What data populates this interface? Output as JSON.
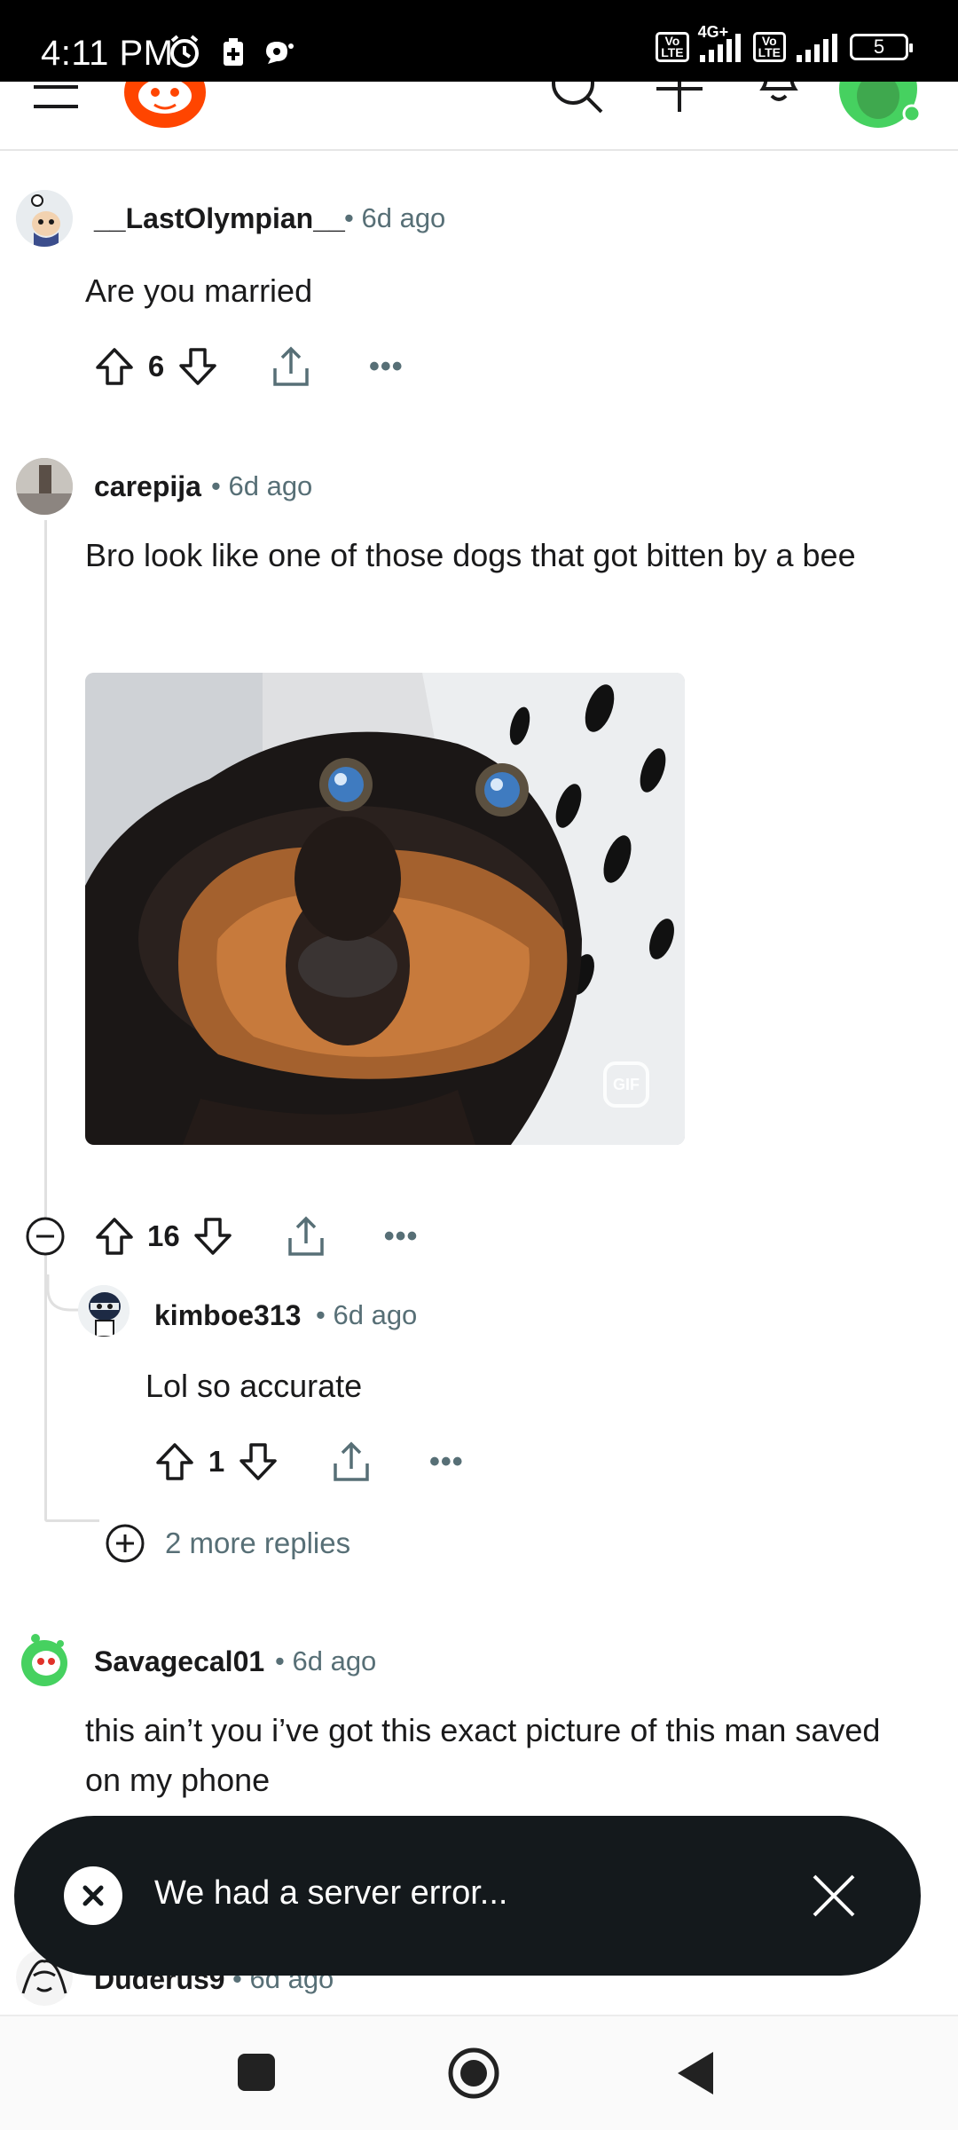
{
  "status_bar": {
    "time": "4:11 PM",
    "network_type": "4G+",
    "volte_label": "Vo\nLTE",
    "battery_level": "5",
    "icons": [
      "alarm-icon",
      "battery-saver-icon",
      "chat-bubble-icon",
      "volte-icon",
      "signal-icon",
      "battery-icon"
    ]
  },
  "header": {
    "icons": [
      "menu-icon",
      "reddit-logo",
      "search-icon",
      "create-post-icon",
      "notifications-icon",
      "user-avatar"
    ],
    "colors": {
      "brand": "#ff4500",
      "notification_dot": "#ff4500",
      "online": "#46d160"
    }
  },
  "comments": [
    {
      "author": "__LastOlympian__",
      "time": "6d ago",
      "body": "Are you married",
      "score": "6"
    },
    {
      "author": "carepija",
      "time": "6d ago",
      "body": "Bro look like one of those dogs that got bitten by a bee",
      "score": "16",
      "media": {
        "type": "gif",
        "badge": "GIF",
        "description_icon": "dog-gif-image"
      },
      "replies": [
        {
          "author": "kimboe313",
          "time": "6d ago",
          "body": "Lol so accurate",
          "score": "1"
        }
      ],
      "more_replies": "2 more replies"
    },
    {
      "author": "Savagecal01",
      "time": "6d ago",
      "body": "this ain’t you i’ve got this exact picture of this man saved on my phone"
    },
    {
      "author": "Duderus9",
      "time": "6d ago"
    }
  ],
  "meta_separator": "•",
  "more_label": "•••",
  "toast": {
    "message": "We had a server error...",
    "icons": [
      "error-x-icon",
      "close-icon"
    ]
  },
  "nav_bar": {
    "icons": [
      "recents-square-icon",
      "home-circle-icon",
      "back-triangle-icon"
    ]
  },
  "colors": {
    "text_primary": "#1a1a1b",
    "text_secondary": "#576f76",
    "toast_bg": "#14191c"
  }
}
